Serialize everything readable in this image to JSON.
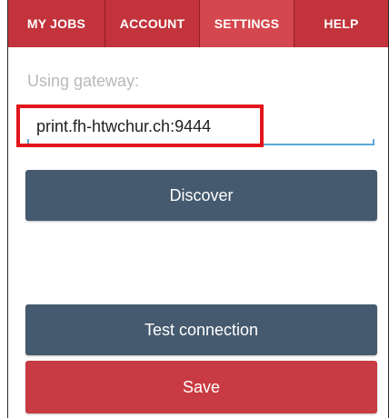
{
  "tabs": [
    {
      "label": "MY JOBS"
    },
    {
      "label": "ACCOUNT"
    },
    {
      "label": "SETTINGS",
      "active": true
    },
    {
      "label": "HELP"
    }
  ],
  "gateway": {
    "label": "Using gateway:",
    "value": "print.fh-htwchur.ch:9444"
  },
  "buttons": {
    "discover": "Discover",
    "test_connection": "Test connection",
    "save": "Save"
  },
  "colors": {
    "tab_bar": "#c2333b",
    "tab_active": "#d4474e",
    "primary_button": "#455a6e",
    "save_button": "#c83b42",
    "input_underline": "#5aa9d9",
    "highlight": "#e3141b"
  }
}
